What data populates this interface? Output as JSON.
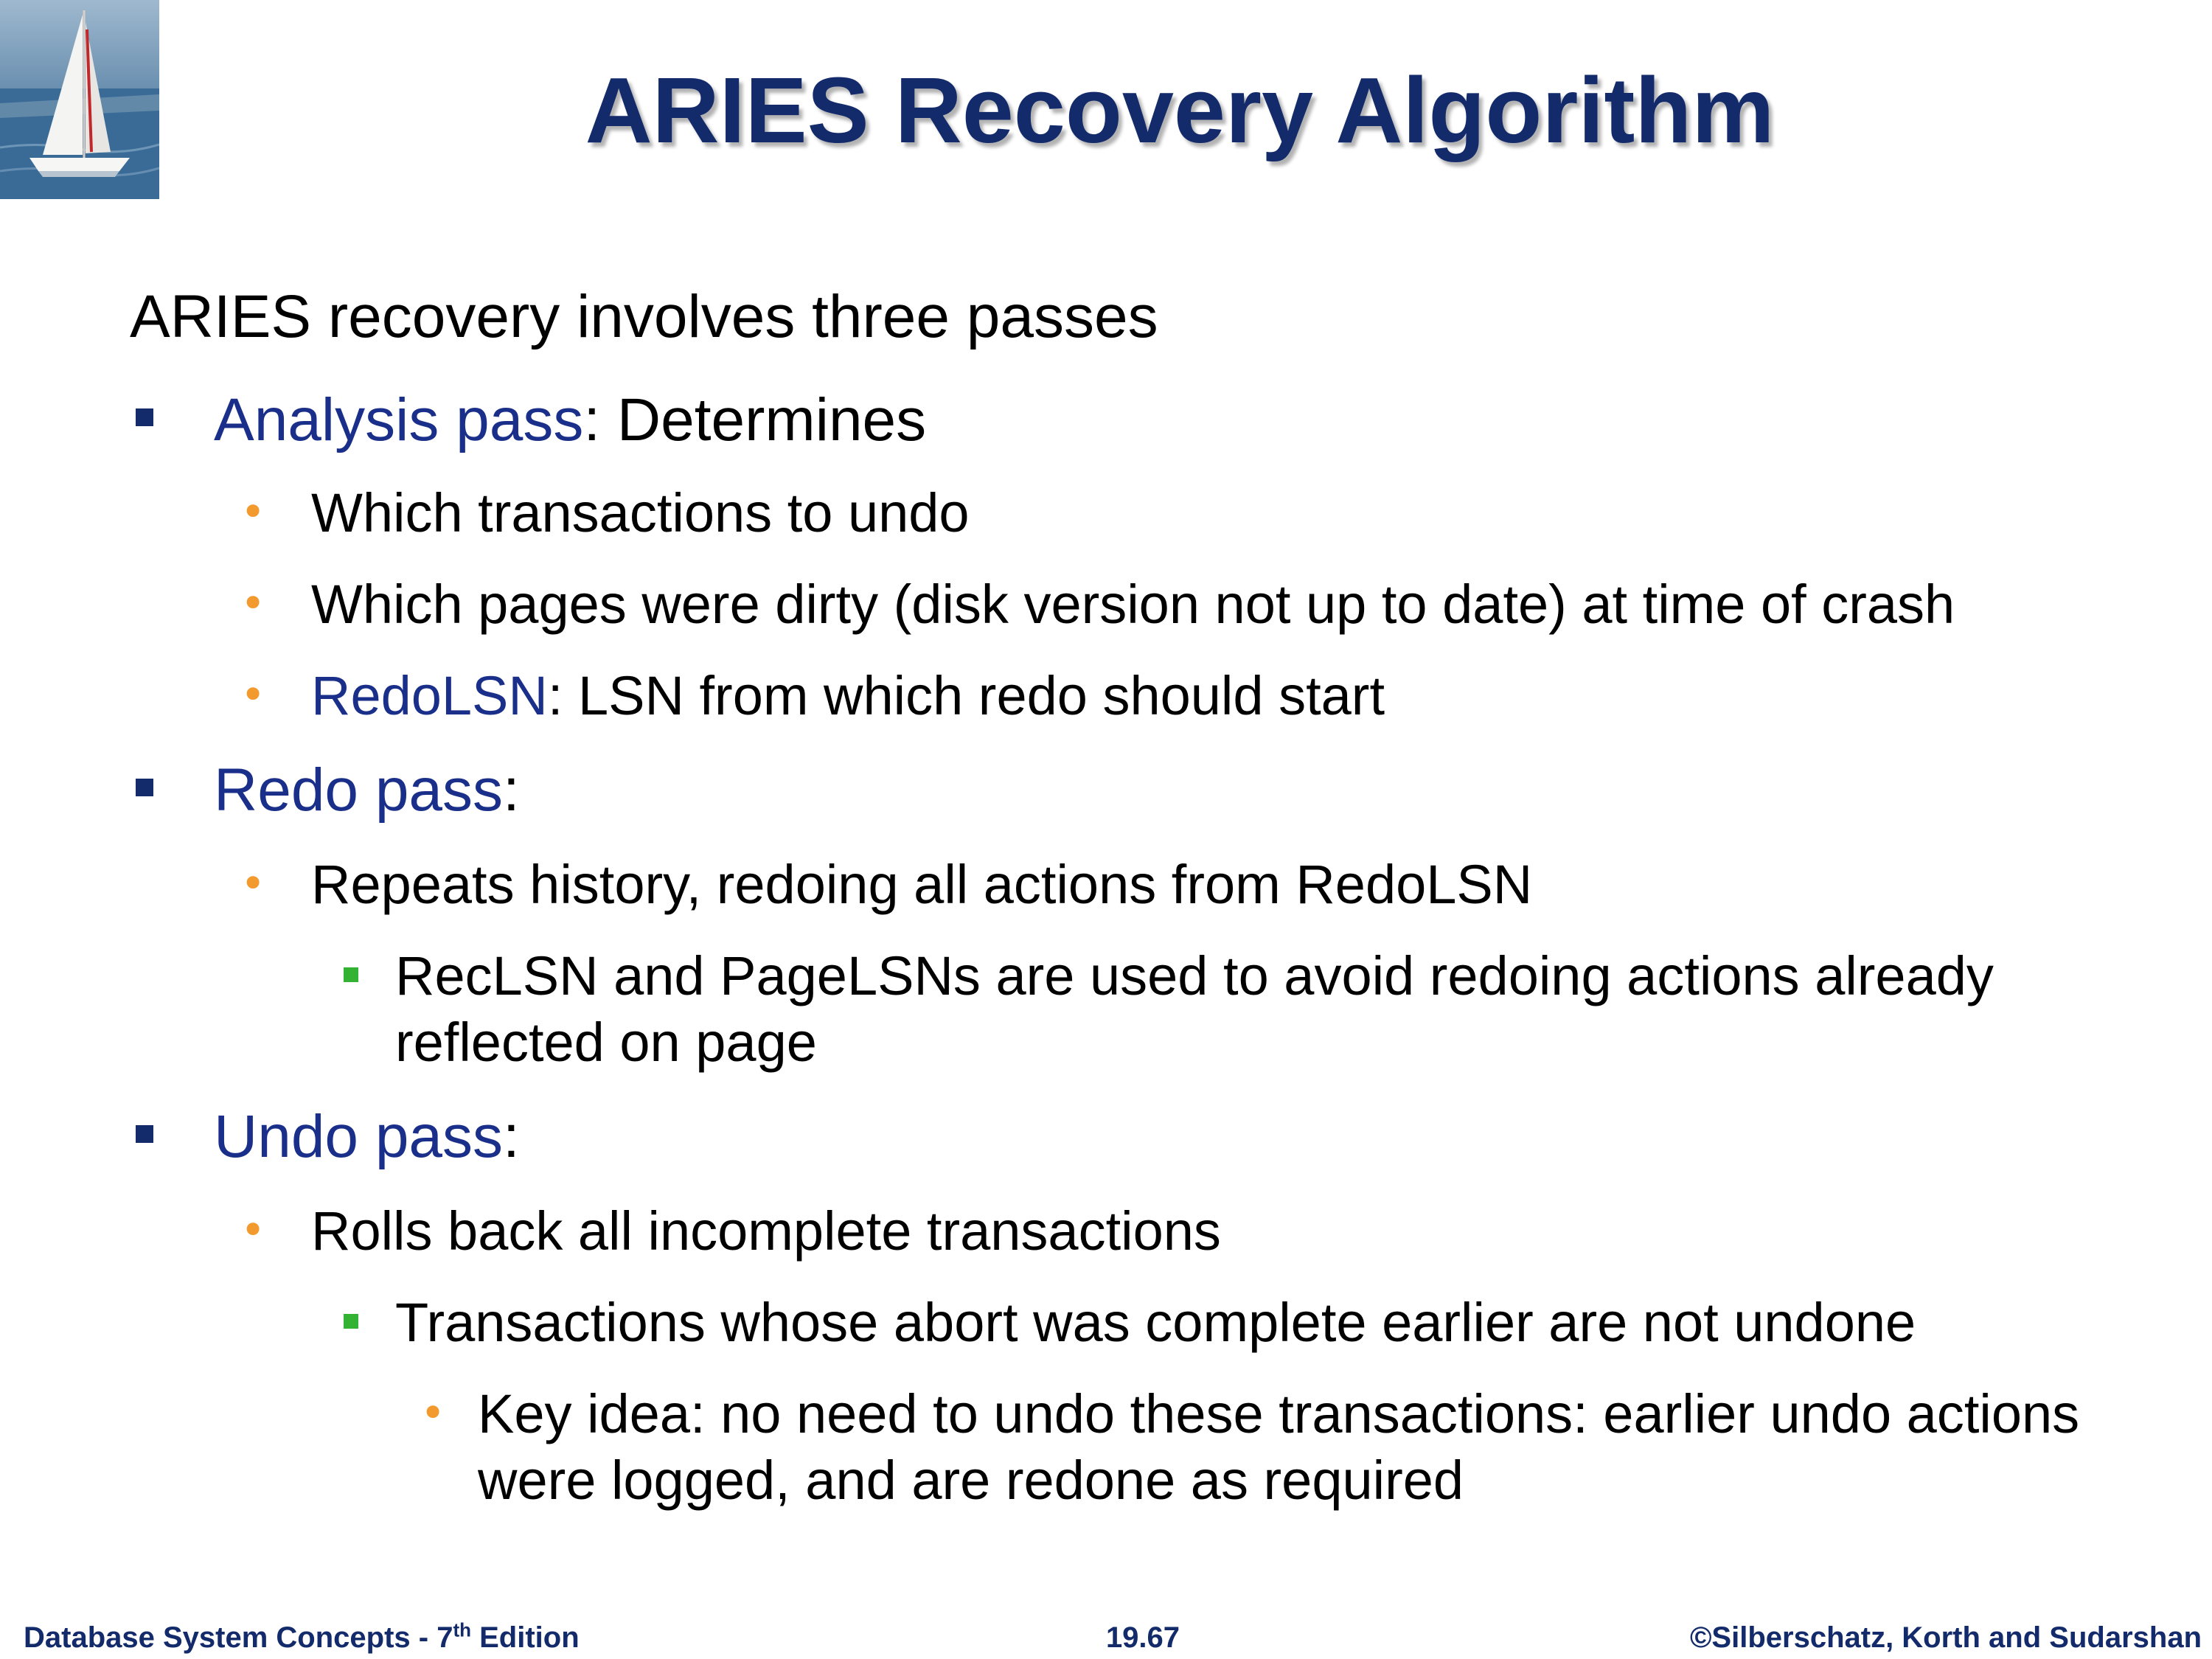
{
  "title": "ARIES Recovery Algorithm",
  "intro": "ARIES recovery involves three passes",
  "passes": [
    {
      "term": "Analysis pass",
      "rest": ": Determines",
      "items": [
        {
          "text": "Which transactions to undo"
        },
        {
          "text": "Which pages were dirty (disk version not up to date) at time of crash"
        },
        {
          "term": "RedoLSN",
          "rest": ": LSN from which redo should start"
        }
      ]
    },
    {
      "term": "Redo pass",
      "rest": ":",
      "items": [
        {
          "text": "Repeats history, redoing all actions from RedoLSN",
          "subitems": [
            {
              "line1": "RecLSN and PageLSNs are used to avoid redoing actions already",
              "line2": "reflected on page"
            }
          ]
        }
      ]
    },
    {
      "term": "Undo pass",
      "rest": ":",
      "items": [
        {
          "text": "Rolls back all incomplete transactions",
          "subitems": [
            {
              "text": "Transactions whose abort was complete earlier are not undone",
              "subitems": [
                {
                  "line1": "Key idea: no need to undo these transactions: earlier undo actions",
                  "line2": "were logged, and are redone as required"
                }
              ]
            }
          ]
        }
      ]
    }
  ],
  "footer": {
    "left_prefix": "Database System Concepts - 7",
    "left_sup": "th",
    "left_suffix": " Edition",
    "center": "19.67",
    "right": "©Silberschatz, Korth and Sudarshan"
  },
  "colors": {
    "title": "#132a6b",
    "term": "#1a2f8a",
    "level1_bullet": "#132a6b",
    "level2_bullet": "#f39a2e",
    "level3_bullet": "#34b233",
    "footer": "#132a6b"
  },
  "icons": {
    "logo": "sailboat-icon",
    "level1_bullet": "square-bullet-icon",
    "level2_bullet": "dot-bullet-icon",
    "level3_bullet": "small-square-bullet-icon"
  }
}
